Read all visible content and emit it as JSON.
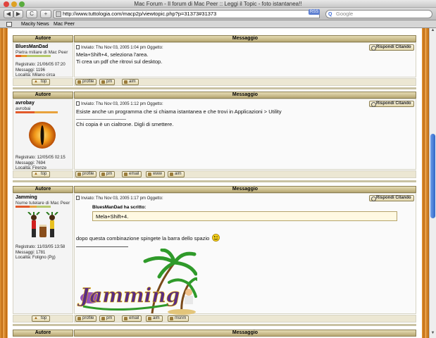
{
  "window": {
    "title": "Mac Forum - Il forum di Mac Peer :: Leggi il Topic - foto istantanea!!"
  },
  "toolbar": {
    "back": "◀",
    "forward": "▶",
    "reload": "C",
    "add": "+",
    "url": "http://www.tuttologia.com/macp2p/viewtopic.php?p=31373#31373",
    "rss": "RSS",
    "search_placeholder": "Google"
  },
  "bookmarks": {
    "book_icon": "book-icon",
    "items": [
      "Macity News",
      "Mac Peer"
    ]
  },
  "headers": {
    "author": "Autore",
    "message": "Messaggio"
  },
  "buttons": {
    "quote": "Rispondi Citando",
    "top": "top",
    "profile": "profile",
    "pm": "pm",
    "email": "email",
    "www": "www",
    "aim": "aim",
    "msnm": "msnm"
  },
  "posts": [
    {
      "author": "BluesManDad",
      "rank": "Pietra miliare di Mac Peer",
      "stats": [
        "Registrato: 21/06/05 07:20",
        "Messaggi: 1196",
        "Località: Milano circa"
      ],
      "meta": "Inviato: Thu Nov 03, 2005 1:04 pm    Oggetto:",
      "lines": [
        "Mela+Shift+4, seleziona l'area.",
        "Ti crea un pdf che ritrovi sul desktop."
      ]
    },
    {
      "author": "avrobay",
      "rank": "avrobai",
      "stats": [
        "Registrato: 12/05/05 02:15",
        "Messaggi: 7694",
        "Località: Firenze"
      ],
      "meta": "Inviato: Thu Nov 03, 2005 1:12 pm    Oggetto:",
      "lines": [
        "Esiste anche un programma che si chiama istantanea e che trovi in Applicazioni > Utility",
        "_________________",
        "Chi copia è un cialtrone. Digli di smettere."
      ]
    },
    {
      "author": "Jamming",
      "rank": "Nume tutelare di Mac Peer",
      "stats": [
        "Registrato: 11/03/05 13:58",
        "Messaggi: 1781",
        "Località: Foligno (Pg)"
      ],
      "meta": "Inviato: Thu Nov 03, 2005 1:17 pm    Oggetto:",
      "quote_author": "BluesManDad ha scritto:",
      "quote_text": "Mela+Shift+4.",
      "lines": [
        "dopo questa combinazione spingete la barra dello spazio"
      ],
      "signature_text": "Jamming"
    }
  ]
}
